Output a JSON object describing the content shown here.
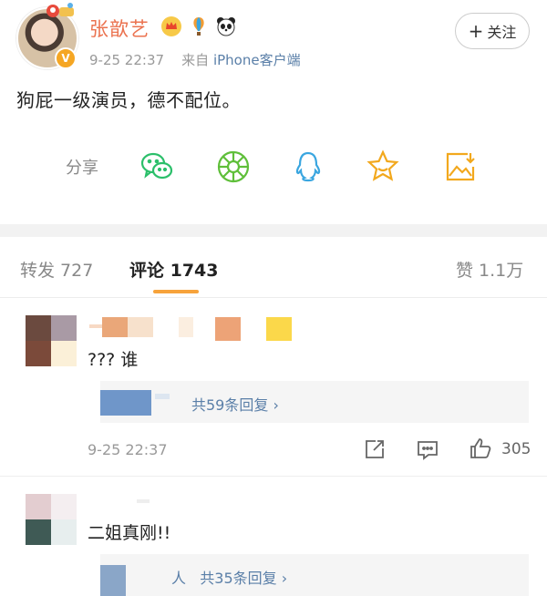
{
  "post": {
    "username": "张歆艺",
    "timestamp": "9-25 22:37",
    "source_prefix": "来自",
    "source": "iPhone客户端",
    "follow_label": "关注",
    "text": "狗屁一级演员，德不配位。"
  },
  "share": {
    "label": "分享",
    "icons": [
      "wechat-icon",
      "moments-icon",
      "qq-icon",
      "favorite-icon",
      "save-image-icon"
    ]
  },
  "tabs": {
    "repost": "转发 727",
    "comments": "评论 1743",
    "likes": "赞 1.1万"
  },
  "comments": [
    {
      "text": "??? 谁",
      "reply_text": "共59条回复",
      "time": "9-25 22:37",
      "likes": "305"
    },
    {
      "text": "二姐真刚!!",
      "reply_prefix": "人",
      "reply_text": "共35条回复"
    }
  ],
  "colors": {
    "username": "#eb7350",
    "link": "#5a7fa8",
    "tab_accent": "#f7a33b"
  }
}
